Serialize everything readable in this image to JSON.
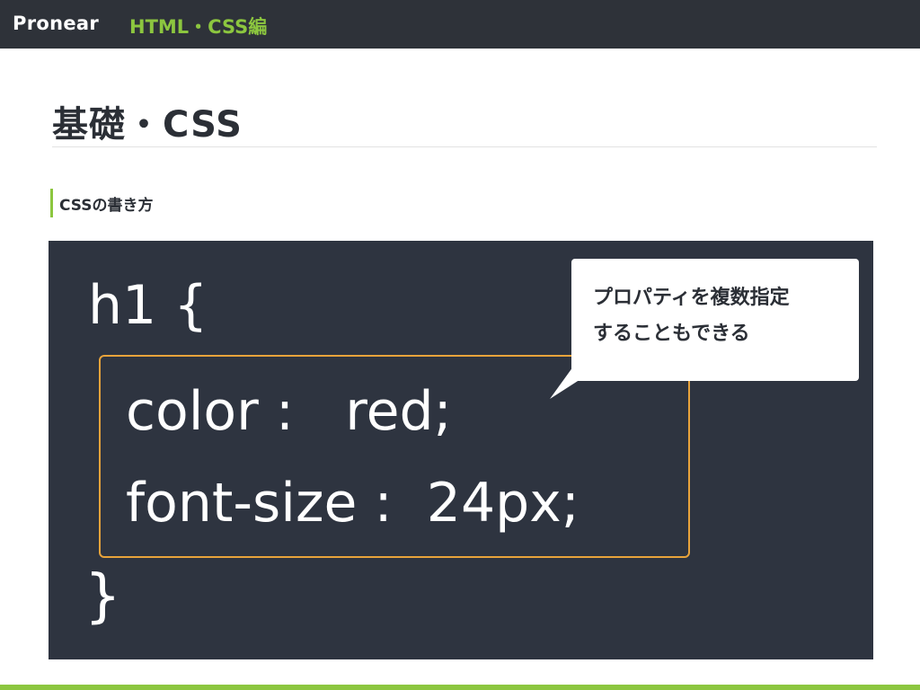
{
  "header": {
    "brand": "Pronear",
    "course": "HTML・CSS編"
  },
  "slide": {
    "title": "基礎・CSS",
    "section_heading": "CSSの書き方"
  },
  "code": {
    "line_open": "h1 {",
    "line_color": "color :   red;",
    "line_font": "font-size :  24px;",
    "line_close": "}"
  },
  "callout": {
    "line1": "プロパティを複数指定",
    "line2": "することもできる"
  },
  "colors": {
    "header_bg": "#2e3239",
    "accent_green": "#8cc63f",
    "code_bg": "#2e3440",
    "highlight_border": "#e8a33b"
  }
}
